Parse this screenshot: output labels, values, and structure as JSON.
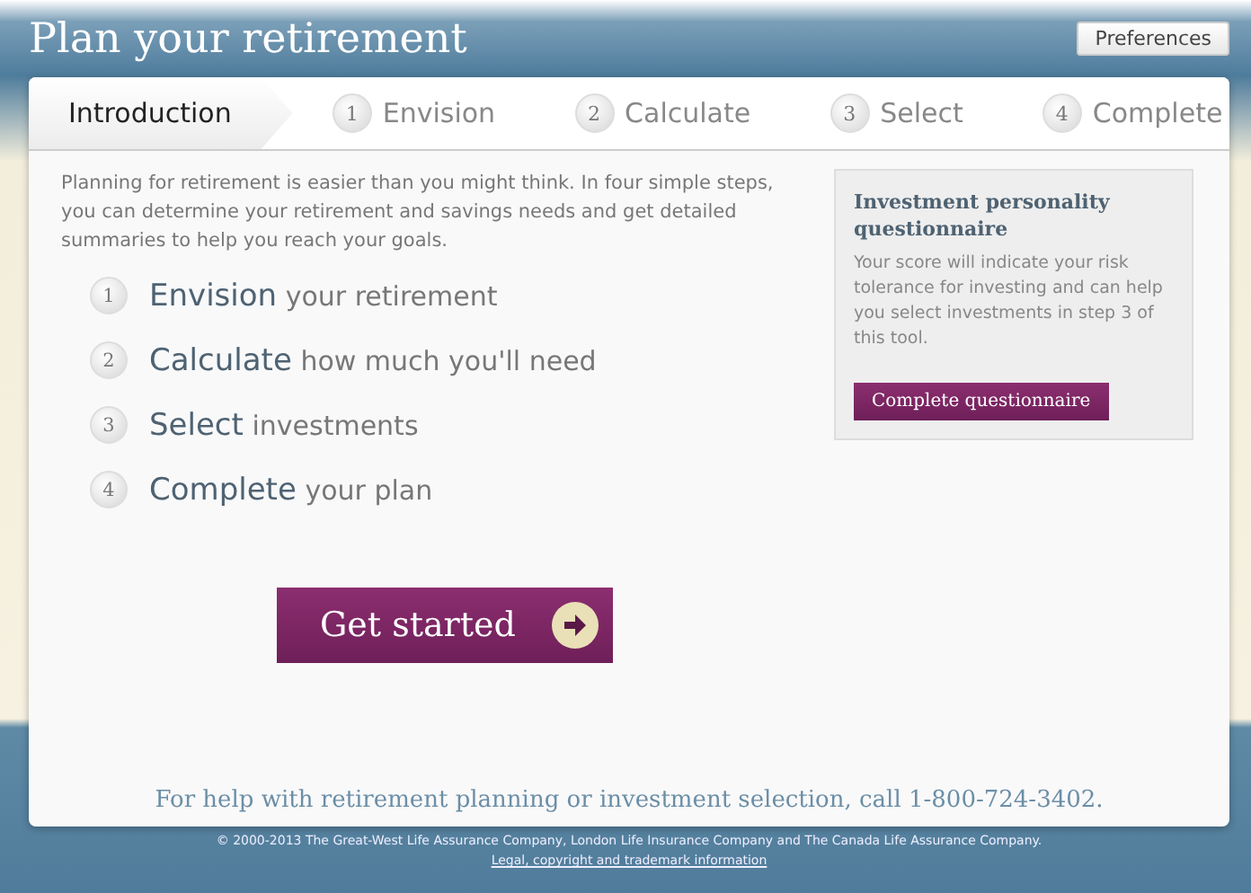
{
  "header": {
    "title": "Plan your retirement",
    "preferences_button": "Preferences"
  },
  "tabs": [
    {
      "label": "Introduction",
      "selected": true
    },
    {
      "number": "1",
      "label": "Envision",
      "selected": false
    },
    {
      "number": "2",
      "label": "Calculate",
      "selected": false
    },
    {
      "number": "3",
      "label": "Select",
      "selected": false
    },
    {
      "number": "4",
      "label": "Complete",
      "selected": false
    }
  ],
  "intro": "Planning for retirement is easier than you might think. In four simple steps, you can determine your retirement and savings needs and get detailed summaries to help you reach your goals.",
  "steps": [
    {
      "number": "1",
      "title": "Envision",
      "rest": "your retirement"
    },
    {
      "number": "2",
      "title": "Calculate",
      "rest": "how much you'll need"
    },
    {
      "number": "3",
      "title": "Select",
      "rest": "investments"
    },
    {
      "number": "4",
      "title": "Complete",
      "rest": "your plan"
    }
  ],
  "start_button": "Get started",
  "questionnaire": {
    "title": "Investment personality questionnaire",
    "text": "Your score will indicate your risk tolerance for investing and can help you select investments in step 3 of this tool.",
    "button": "Complete questionnaire"
  },
  "help": "For help with retirement planning or investment selection, call 1-800-724-3402.",
  "footer": {
    "copyright": "© 2000-2013 The Great-West Life Assurance Company, London Life Insurance Company and The Canada Life Assurance Company.",
    "link": "Legal, copyright and trademark information"
  }
}
